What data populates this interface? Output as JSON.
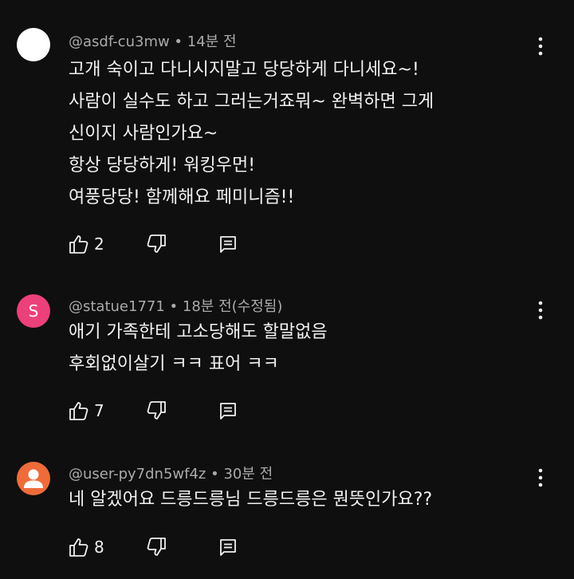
{
  "comments": [
    {
      "avatar_letter": "",
      "handle": "@asdf-cu3mw",
      "time": " • 14분 전",
      "lines": [
        "고개 숙이고 다니시지말고 당당하게 다니세요~!",
        "사람이 실수도 하고 그러는거죠뭐~ 완벽하면 그게",
        "신이지 사람인가요~",
        "항상 당당하게! 워킹우먼!",
        "여풍당당! 함께해요 페미니즘!!"
      ],
      "likes": "2"
    },
    {
      "avatar_letter": "S",
      "handle": "@statue1771",
      "time": " • 18분 전(수정됨)",
      "lines": [
        "애기 가족한테 고소당해도 할말없음",
        "후회없이살기 ㅋㅋ 표어 ㅋㅋ"
      ],
      "likes": "7"
    },
    {
      "avatar_letter": "",
      "handle": "@user-py7dn5wf4z",
      "time": " • 30분 전",
      "lines": [
        "네 알겠어요 드릉드릉님 드릉드릉은 뭔뜻인가요??"
      ],
      "likes": "8"
    }
  ],
  "icons": {
    "like": "thumbs-up-icon",
    "dislike": "thumbs-down-icon",
    "reply": "reply-icon",
    "more": "more-vert-icon",
    "default_avatar": "person-icon"
  },
  "colors": {
    "background": "#0f0f0f",
    "text": "#f1f1f1",
    "meta": "#aaaaaa",
    "avatar_pink": "#ec407a",
    "avatar_orange": "#ef6c3a"
  }
}
